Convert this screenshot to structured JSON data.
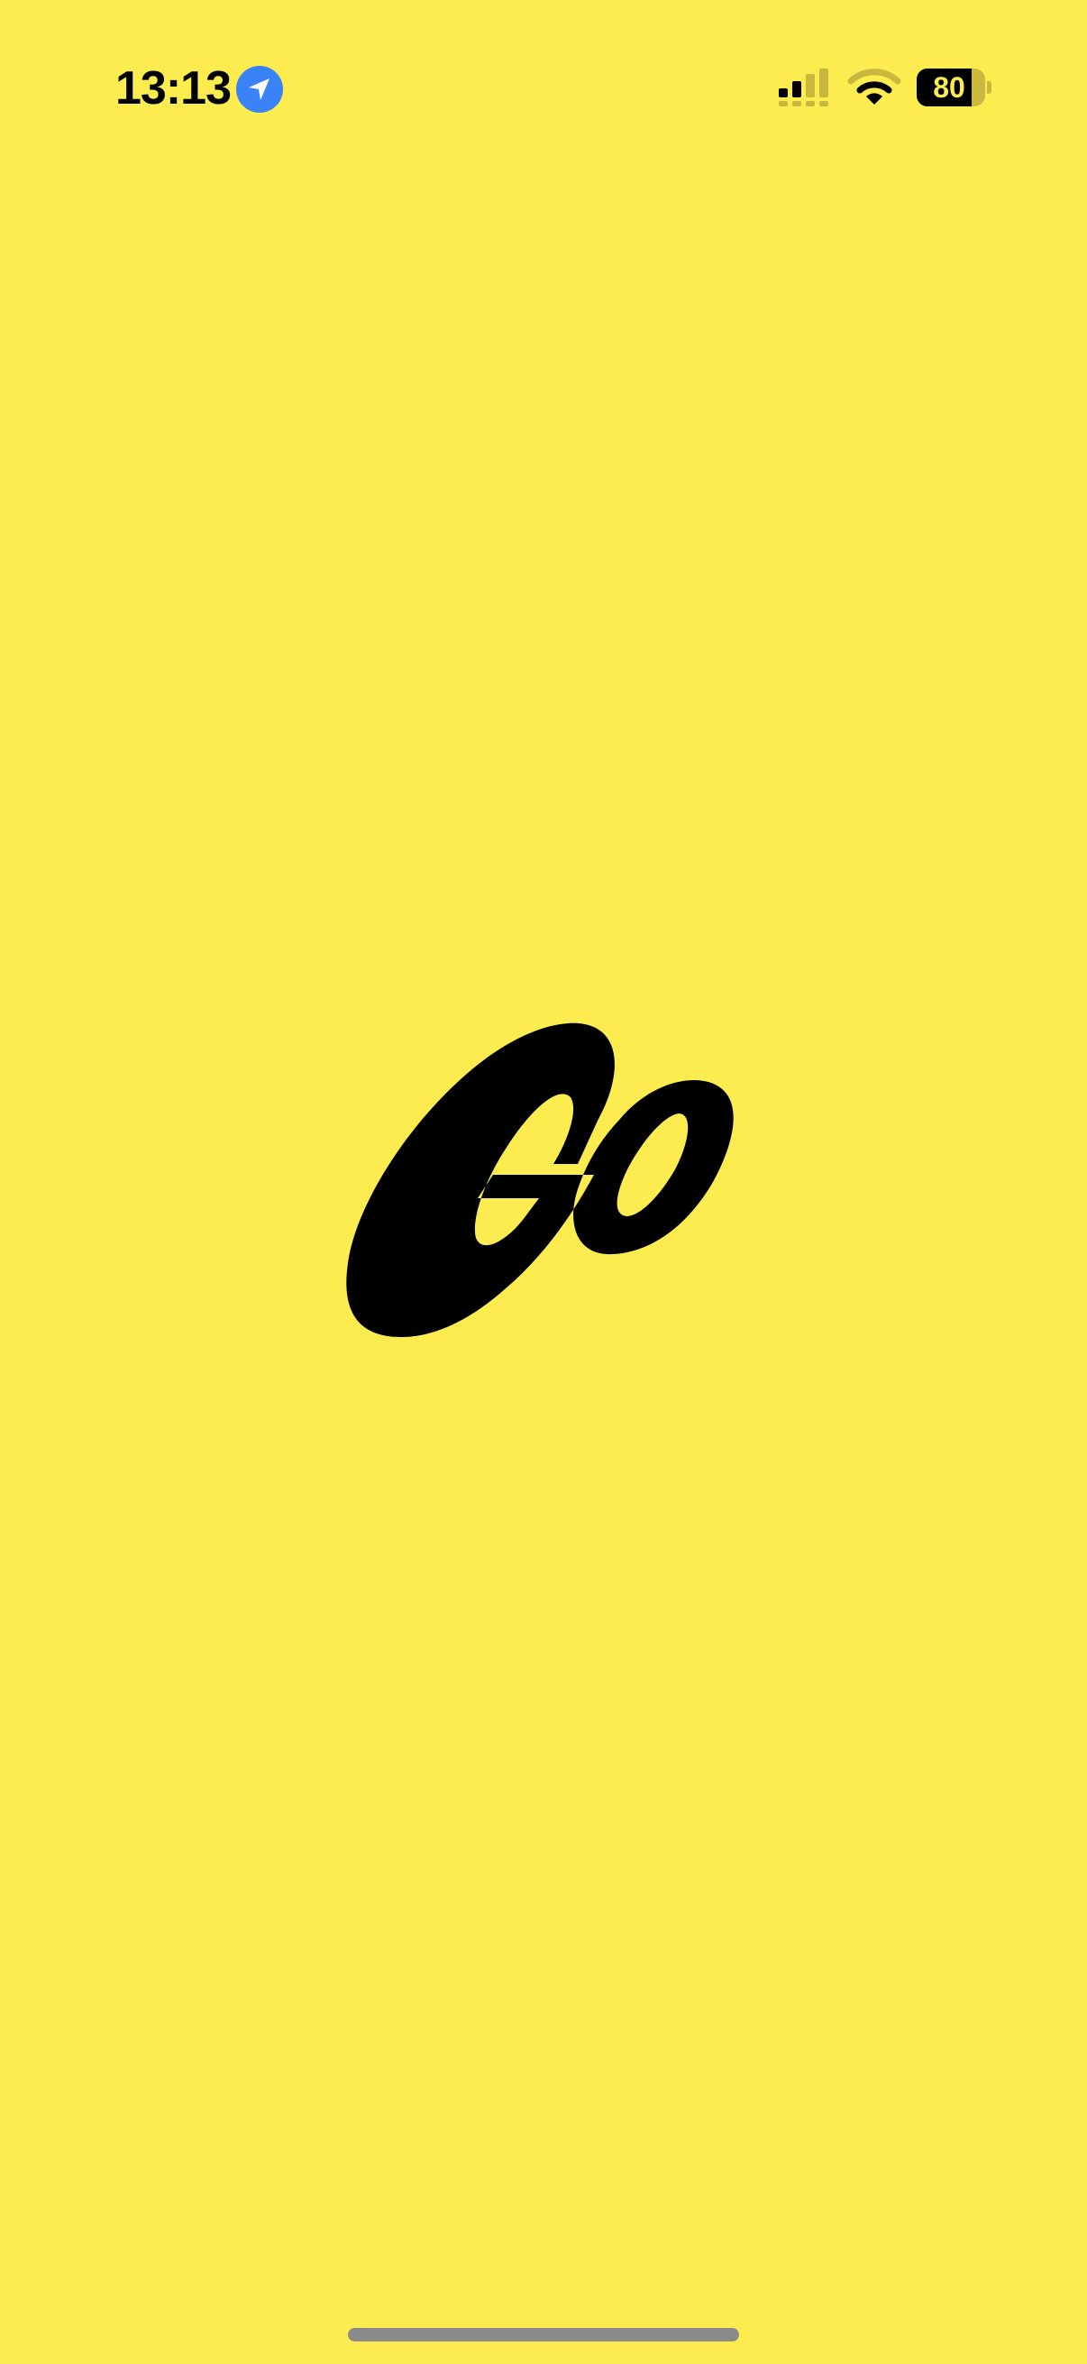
{
  "status_bar": {
    "time": "13:13",
    "battery_percent": 80,
    "battery_label": "80",
    "signal_bars_active": 2,
    "signal_bars_total": 4,
    "location_icon": "location-arrow-icon",
    "wifi_icon": "wifi-icon"
  },
  "logo": {
    "icon": "go-logo-icon"
  },
  "colors": {
    "background": "#FCEC50",
    "logo": "#000000",
    "location_badge": "#3A82F7",
    "home_indicator": "#8A8A8A"
  }
}
